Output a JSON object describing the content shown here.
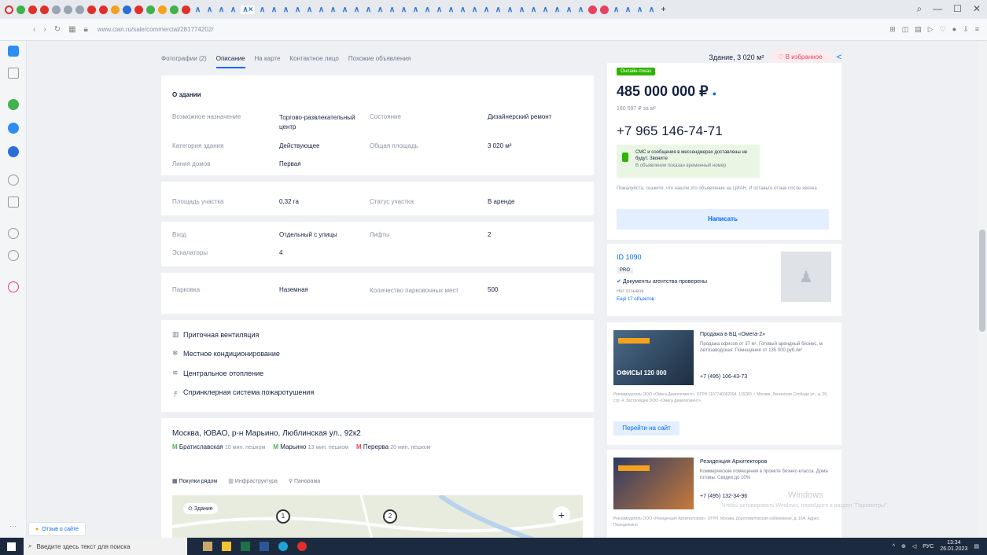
{
  "browser": {
    "url": "www.cian.ru/sale/commercial/281774202/",
    "win_min": "—",
    "win_max": "☐",
    "win_close": "✕"
  },
  "subnav": {
    "items": [
      "Фотографии (2)",
      "Описание",
      "На карте",
      "Контактное лицо",
      "Похожие объявления"
    ],
    "active_index": 1,
    "building": "Здание, 3 020 м²",
    "fav": "В избранное"
  },
  "building_card": {
    "title": "О здании",
    "rows": [
      {
        "l1": "Возможное назначение",
        "v1": "Торгово-развлекательный центр",
        "l2": "Состояние",
        "v2": "Дизайнерский ремонт"
      },
      {
        "l1": "Категория здания",
        "v1": "Действующее",
        "l2": "Общая площадь",
        "v2": "3 020 м²"
      },
      {
        "l1": "Линия домов",
        "v1": "Первая",
        "l2": "",
        "v2": ""
      },
      {
        "l1": "Площадь участка",
        "v1": "0,32 га",
        "l2": "Статус участка",
        "v2": "В аренде"
      },
      {
        "l1": "Вход",
        "v1": "Отдельный с улицы",
        "l2": "Лифты",
        "v2": "2"
      },
      {
        "l1": "Эскалаторы",
        "v1": "4",
        "l2": "",
        "v2": ""
      },
      {
        "l1": "Парковка",
        "v1": "Наземная",
        "l2": "Количество парковочных мест",
        "v2": "500"
      }
    ],
    "features": [
      {
        "icon": "vent-icon",
        "glyph": "▥",
        "text": "Приточная вентиляция"
      },
      {
        "icon": "ac-icon",
        "glyph": "❄",
        "text": "Местное кондиционирование"
      },
      {
        "icon": "heating-icon",
        "glyph": "≋",
        "text": "Центральное отопление"
      },
      {
        "icon": "sprinkler-icon",
        "glyph": "╒",
        "text": "Спринклерная система пожаротушения"
      }
    ]
  },
  "address": {
    "text": "Москва, ЮВАО, р-н Марьино, Люблинская ул., 92к2",
    "metro": [
      {
        "name": "Братиславская",
        "time": "10 мин. пешком",
        "color": "#4fb04f"
      },
      {
        "name": "Марьино",
        "time": "13 мин. пешком",
        "color": "#4fb04f"
      },
      {
        "name": "Перерва",
        "time": "20 мин. пешком",
        "color": "#e84260"
      }
    ],
    "map_tabs": [
      "Покупки рядом",
      "Инфраструктура",
      "Панорама"
    ],
    "map_building": "Здание",
    "map_markers": [
      "1",
      "2"
    ],
    "map_plus": "+"
  },
  "price_card": {
    "badge": "Онлайн-показ",
    "price": "485 000 000 ₽",
    "price_per": "160 597 ₽ за м²",
    "phone": "+7 965 146-74-71",
    "sms_title": "СМС и сообщения в мессенджерах доставлены не будут. Звоните",
    "sms_sub": "В объявлении показан временный номер",
    "note": "Пожалуйста, скажите, что нашли это объявление на ЦИАН. И оставьте отзыв после звонка",
    "write_btn": "Написать"
  },
  "agent_card": {
    "id": "ID 1090",
    "pro": "PRO",
    "verified": "Документы агентства проверены",
    "reviews": "Нет отзывов",
    "more": "Ещё 17 объектов"
  },
  "ad1": {
    "title": "Продажа в БЦ «Омега-2»",
    "text": "Продажа офисов от 37 м². Готовый арендный бизнес, м Автозаводская. Помещения от 135 000 руб./м²",
    "phone": "+7 (495) 106-43-73",
    "img_text": "ОФИСЫ  120 000",
    "legal": "Рекламодатель ООО «Омега Девелопмент». ОГРН 1107746062994. 115280, г. Москва, Ленинская Слобода ул., д. 26, стр. 4. Застройщик ООО «Омега Девелопмент»",
    "btn": "Перейти на сайт"
  },
  "ad2": {
    "title": "Резиденция Архитекторов",
    "text": "Коммерческие помещения в проекте бизнес-класса. Дома готовы. Скидки до 10%",
    "phone": "+7 (495) 132-34-96",
    "legal": "Рекламодатель ООО «Резиденция Архитекторов». ОГРН. Москва, Дорогомиловская набережная, д. 16А. Адрес: Переделкино"
  },
  "feedback": "Отзыв о сайте",
  "windows_watermark": "Windows",
  "windows_watermark2": "Чтобы активировать Windows, перейдите в раздел \"Параметры\".",
  "taskbar": {
    "search": "Введите здесь текст для поиска",
    "lang": "РУС",
    "time": "13:34",
    "date": "26.01.2023"
  },
  "colors": {
    "accent": "#0468ff",
    "text": "#152242",
    "muted": "#8a93a3",
    "badge_green": "#2fb400"
  }
}
